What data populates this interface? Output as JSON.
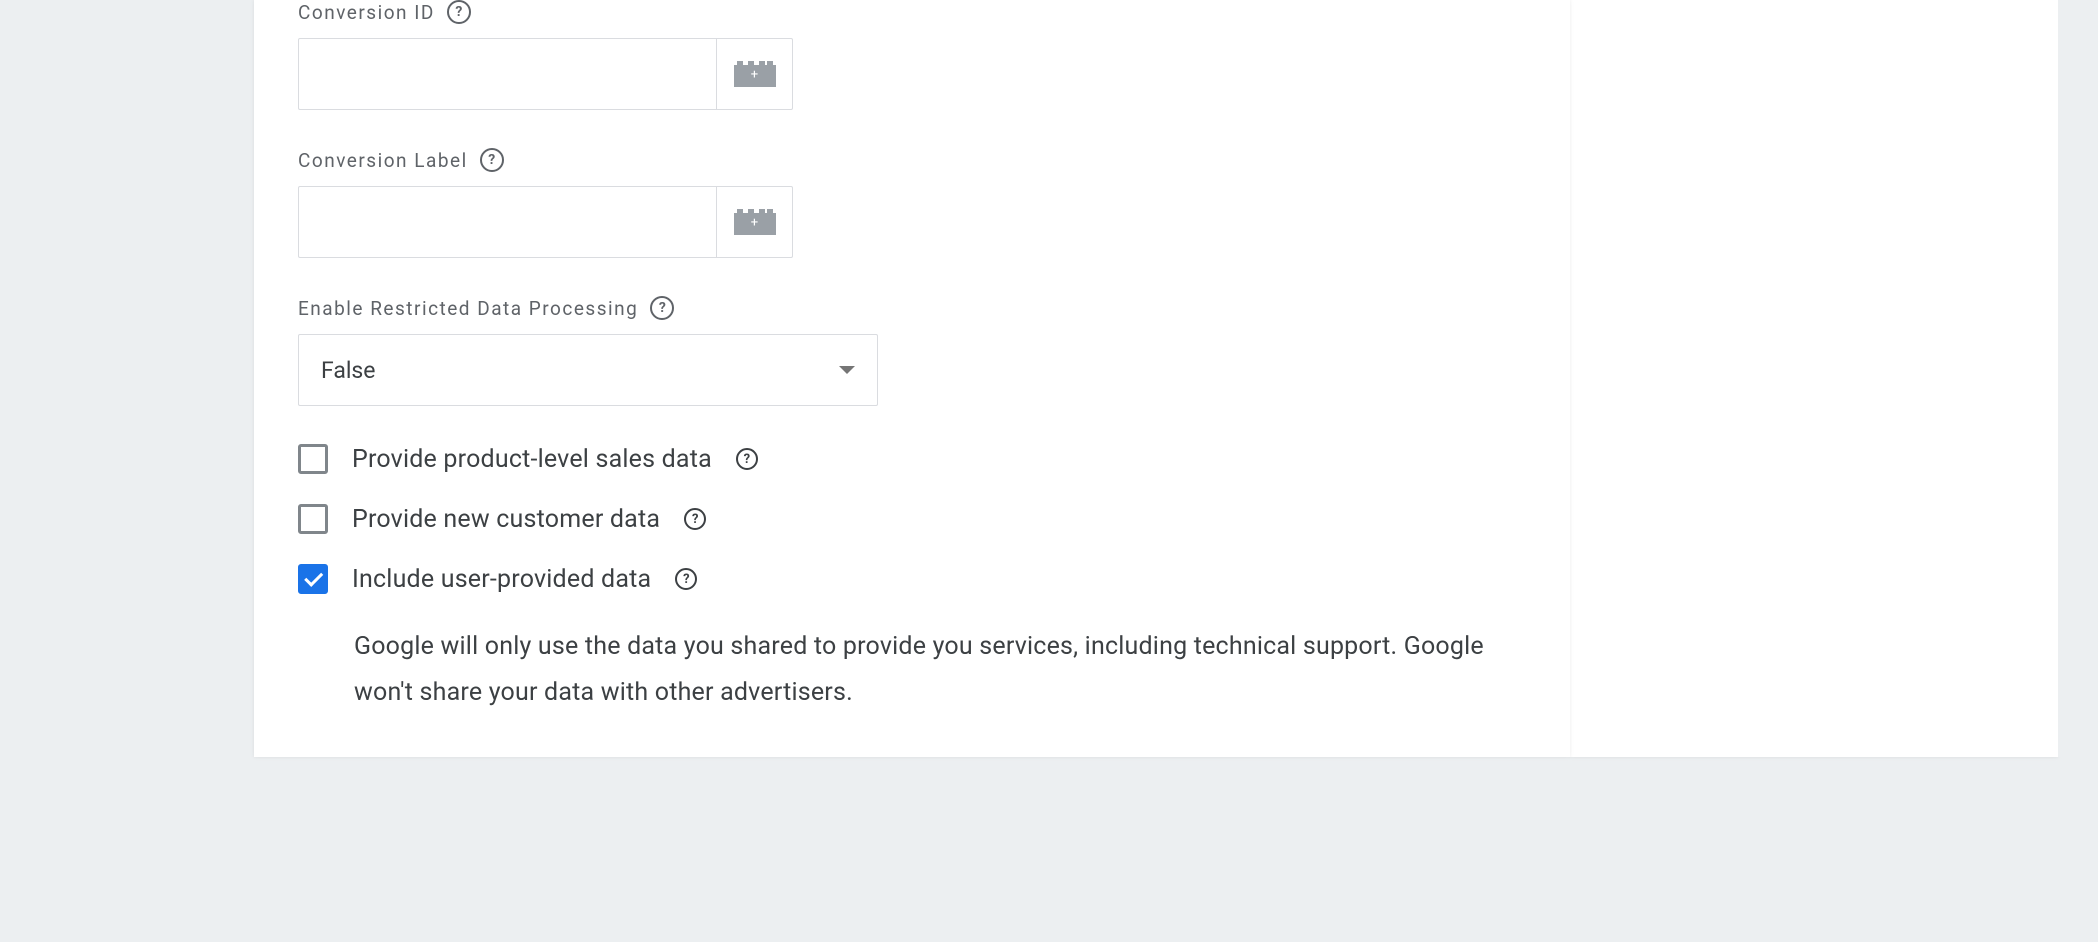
{
  "fields": {
    "conversionId": {
      "label": "Conversion ID",
      "value": ""
    },
    "conversionLabel": {
      "label": "Conversion Label",
      "value": ""
    },
    "restrictedDataProcessing": {
      "label": "Enable Restricted Data Processing",
      "value": "False"
    }
  },
  "checkboxes": {
    "productLevel": {
      "label": "Provide product-level sales data",
      "checked": false
    },
    "newCustomer": {
      "label": "Provide new customer data",
      "checked": false
    },
    "userProvided": {
      "label": "Include user-provided data",
      "checked": true,
      "description": "Google will only use the data you shared to provide you services, including technical support. Google won't share your data with other advertisers."
    }
  },
  "icons": {
    "help": "?"
  }
}
